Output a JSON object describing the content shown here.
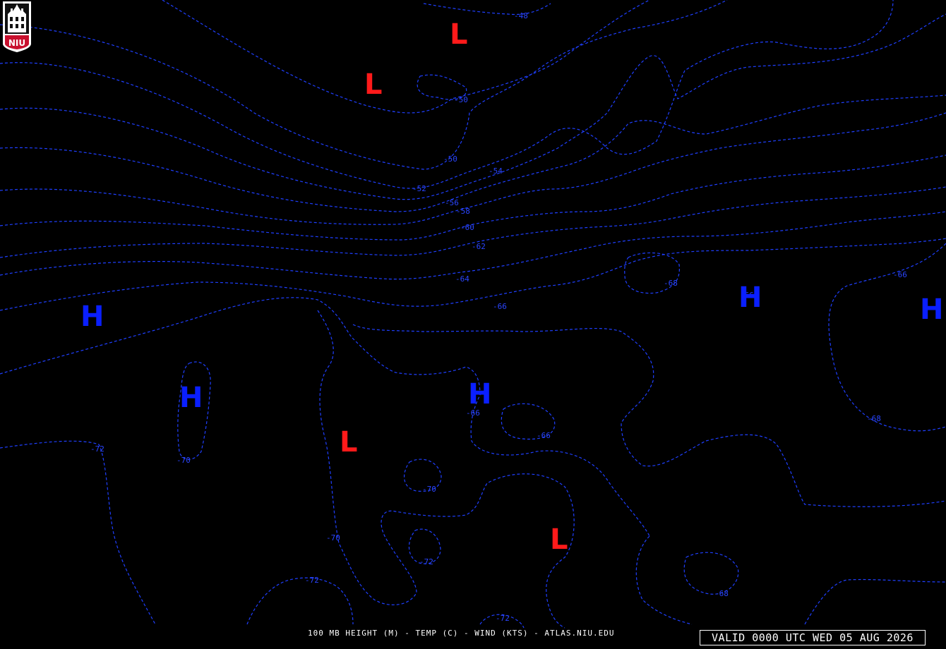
{
  "footer": {
    "caption": "100 MB HEIGHT (M) - TEMP (C) - WIND (KTS) - ATLAS.NIU.EDU",
    "valid_time": "VALID 0000 UTC WED 05 AUG 2026"
  },
  "logo": {
    "text": "NIU"
  },
  "map": {
    "line_color": "#1f3fff",
    "high_color": "#0a1fff",
    "low_color": "#ff1a1a",
    "contour_labels": [
      "-48",
      "-50",
      "-50",
      "-52",
      "-54",
      "-56",
      "-58",
      "-60",
      "-62",
      "-64",
      "-66",
      "-68",
      "-66",
      "-68",
      "-66",
      "-66",
      "-68",
      "-70",
      "-72",
      "-70",
      "-70",
      "-72",
      "-72",
      "-72",
      "-66"
    ],
    "highs": [
      "H",
      "H",
      "H",
      "H",
      "H"
    ],
    "lows": [
      "L",
      "L",
      "L",
      "L"
    ]
  }
}
